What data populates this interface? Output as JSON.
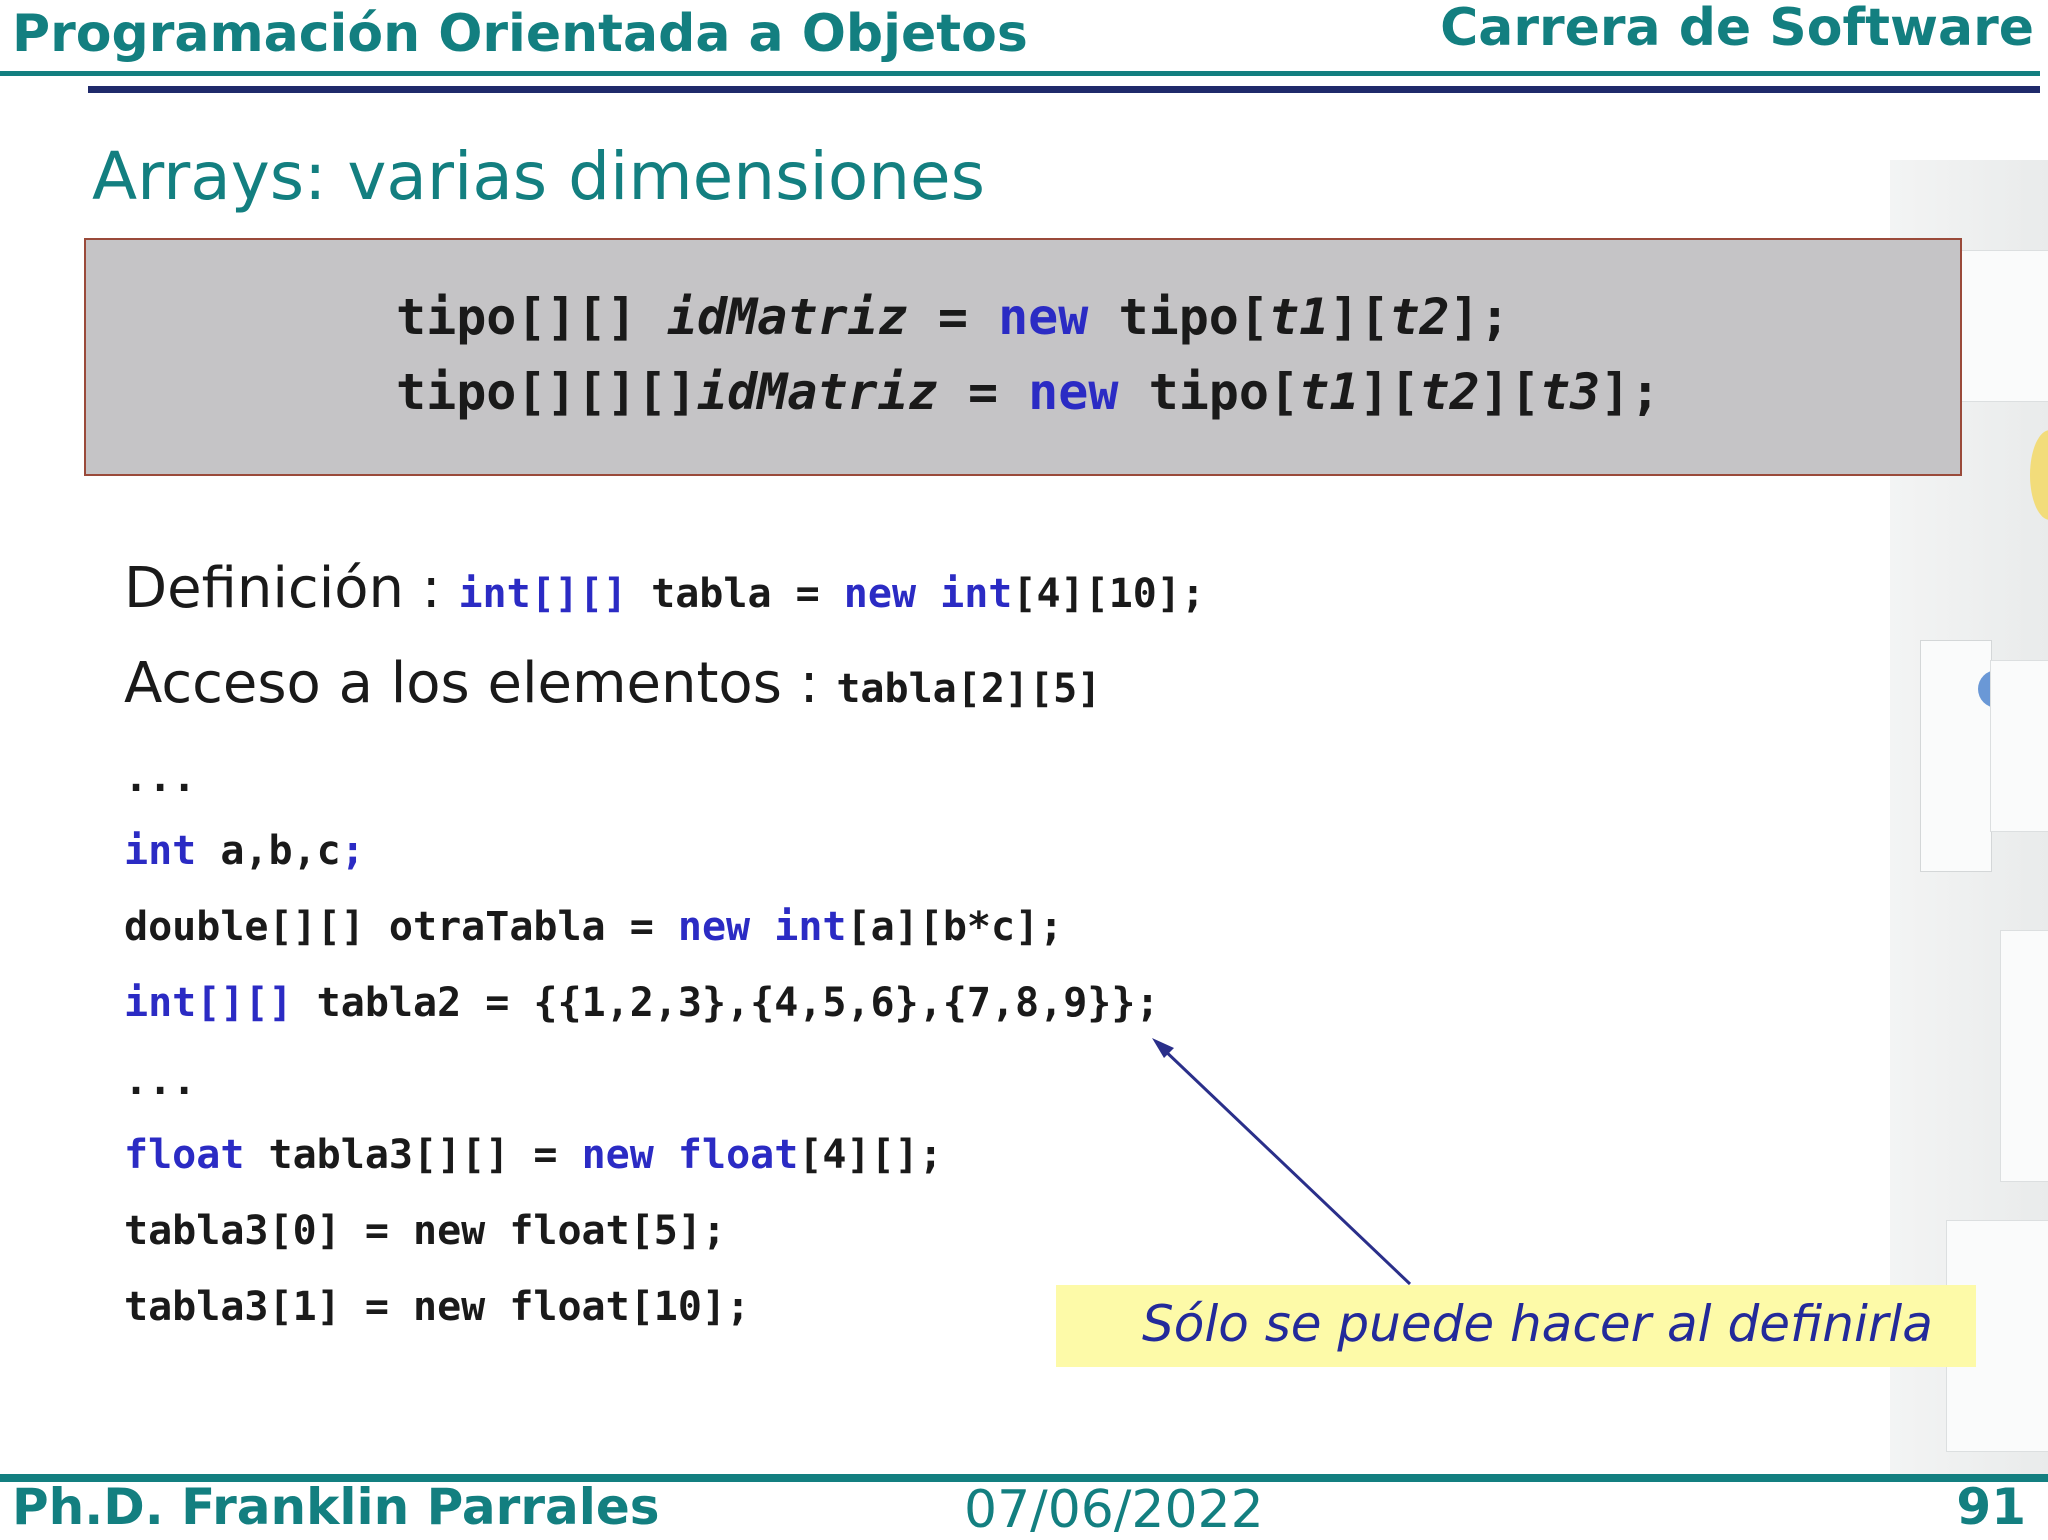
{
  "header": {
    "course": "Programación Orientada a Objetos",
    "career": "Carrera de Software"
  },
  "slide": {
    "title": "Arrays: varias dimensiones"
  },
  "syntax": {
    "line1": {
      "t_a": "tipo[][] ",
      "id": "idMatriz",
      "eq": " = ",
      "kw": "new",
      "t_b": " tipo[",
      "p1": "t1",
      "mid": "][",
      "p2": "t2",
      "end": "];"
    },
    "line2": {
      "t_a": "tipo[][][]",
      "id": "idMatriz",
      "eq": " = ",
      "kw": "new",
      "t_b": " tipo[",
      "p1": "t1",
      "mid1": "][",
      "p2": "t2",
      "mid2": "][",
      "p3": "t3",
      "end": "];"
    }
  },
  "definition": {
    "label": "Definición",
    "colon": " : ",
    "type": "int[][]",
    "name": " tabla = ",
    "kw_new": "new",
    "sp": " ",
    "kw_int": "int",
    "dims": "[4][10];"
  },
  "access": {
    "label": "Acceso a los elementos",
    "colon": " : ",
    "expr": "tabla[2][5]"
  },
  "code": {
    "ellipsis": "...",
    "l1_kw": "int",
    "l1_rest": " a,b,c",
    "l1_semi": ";",
    "l2_a": "double[][] otraTabla = ",
    "l2_kw_new": "new",
    "l2_sp": " ",
    "l2_kw_int": "int",
    "l2_rest": "[a][b*c];",
    "l3_kw": "int[][]",
    "l3_rest": " tabla2 = {{1,2,3},{4,5,6},{7,8,9}};",
    "l4_kw_float": "float",
    "l4_a": " tabla3[][] = ",
    "l4_kw_new": "new",
    "l4_sp": " ",
    "l4_kw_float2": "float",
    "l4_rest": "[4][];",
    "l5": "tabla3[0] = new float[5];",
    "l6": "tabla3[1] = new float[10];"
  },
  "note": {
    "text": "Sólo se puede hacer al definirla"
  },
  "footer": {
    "author": "Ph.D. Franklin Parrales",
    "date": "07/06/2022",
    "page": "91"
  },
  "colors": {
    "teal": "#137f80",
    "navy": "#1f2a6b",
    "keyword": "#2b2bc4",
    "box_fill": "#c5c4c6",
    "note_fill": "#fdfaa8"
  }
}
